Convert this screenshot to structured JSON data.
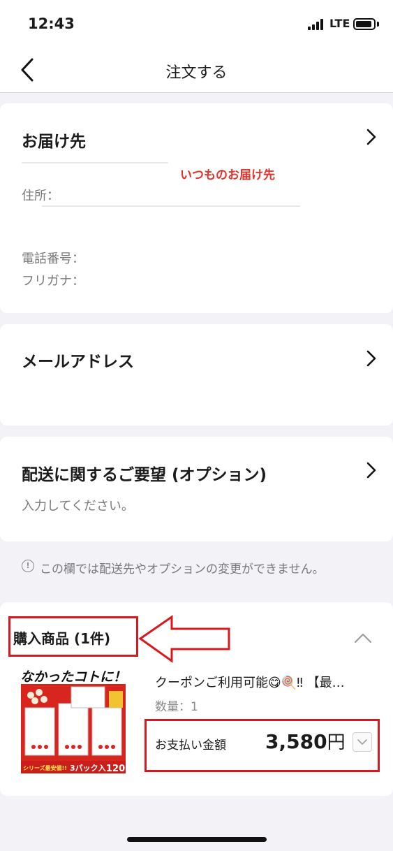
{
  "status_bar": {
    "time": "12:43",
    "network": "LTE"
  },
  "nav": {
    "title": "注文する"
  },
  "delivery": {
    "title": "お届け先",
    "tag": "いつものお届け先",
    "address_label": "住所：",
    "phone_label": "電話番号：",
    "furigana_label": "フリガナ："
  },
  "email": {
    "title": "メールアドレス"
  },
  "request": {
    "title": "配送に関するご要望 (オプション)",
    "placeholder": "入力してください。"
  },
  "notice": {
    "icon": "!",
    "text": "この欄では配送先やオプションの変更ができません。"
  },
  "purchase": {
    "title": "購入商品 (1件)",
    "product": {
      "name": "クーポンご利用可能😋🍭‼ 【最…",
      "quantity": "数量：1",
      "pay_label": "お支払い金額",
      "amount": "3,580",
      "currency": "円"
    },
    "thumbnail": {
      "headline": "なかったコトに！",
      "banner": "シリーズ最安値!!",
      "pack": "3パック入",
      "count": "120"
    }
  },
  "colors": {
    "accent_red": "#d7191f",
    "tag_red": "#e0342c",
    "background": "#f2f2f7"
  }
}
